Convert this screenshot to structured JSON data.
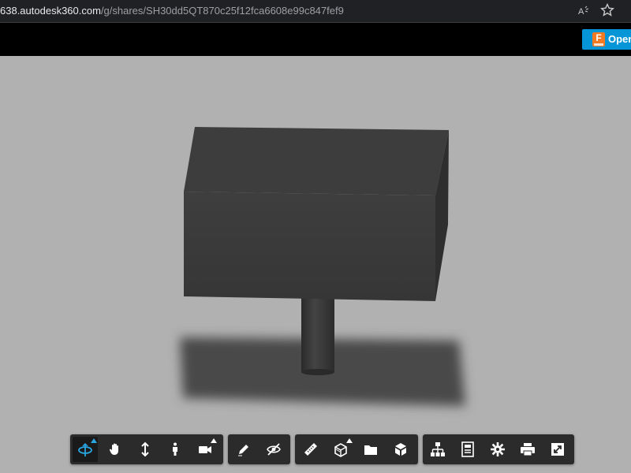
{
  "browser": {
    "url_host": "638.autodesk360.com",
    "url_path": "/g/shares/SH30dd5QT870c25f12fca6608e99c847fef9",
    "read_aloud_icon": "read-aloud-icon",
    "favorite_icon": "star-icon"
  },
  "header": {
    "open_button_label": "Open",
    "open_button_icon": "fusion-logo-icon",
    "logo_letter": "F"
  },
  "colors": {
    "accent": "#0696d7",
    "toolbar_bg": "#2b2b2b",
    "active_tool": "#2aa6e0",
    "viewport_bg": "#b1b1b1"
  },
  "toolbar": {
    "navigation": [
      {
        "name": "orbit-tool",
        "icon": "orbit-icon",
        "active": true,
        "has_flyout": true
      },
      {
        "name": "pan-tool",
        "icon": "hand-icon",
        "active": false,
        "has_flyout": false
      },
      {
        "name": "zoom-tool",
        "icon": "zoom-arrows-icon",
        "active": false,
        "has_flyout": false
      },
      {
        "name": "first-person-tool",
        "icon": "person-icon",
        "active": false,
        "has_flyout": false
      },
      {
        "name": "camera-tool",
        "icon": "camera-icon",
        "active": false,
        "has_flyout": true
      }
    ],
    "markup": [
      {
        "name": "markup-tool",
        "icon": "pencil-icon"
      },
      {
        "name": "visibility-tool",
        "icon": "eye-slash-icon"
      }
    ],
    "analysis": [
      {
        "name": "measure-tool",
        "icon": "ruler-icon",
        "has_flyout": false
      },
      {
        "name": "section-tool",
        "icon": "section-box-icon",
        "has_flyout": true
      },
      {
        "name": "explode-tool",
        "icon": "folder-icon",
        "has_flyout": false
      },
      {
        "name": "model-tool",
        "icon": "cube-icon",
        "has_flyout": false
      }
    ],
    "settings": [
      {
        "name": "model-browser",
        "icon": "hierarchy-icon"
      },
      {
        "name": "properties",
        "icon": "properties-icon"
      },
      {
        "name": "settings",
        "icon": "gear-icon"
      },
      {
        "name": "print",
        "icon": "printer-icon"
      },
      {
        "name": "fullscreen",
        "icon": "fullscreen-icon"
      }
    ]
  }
}
